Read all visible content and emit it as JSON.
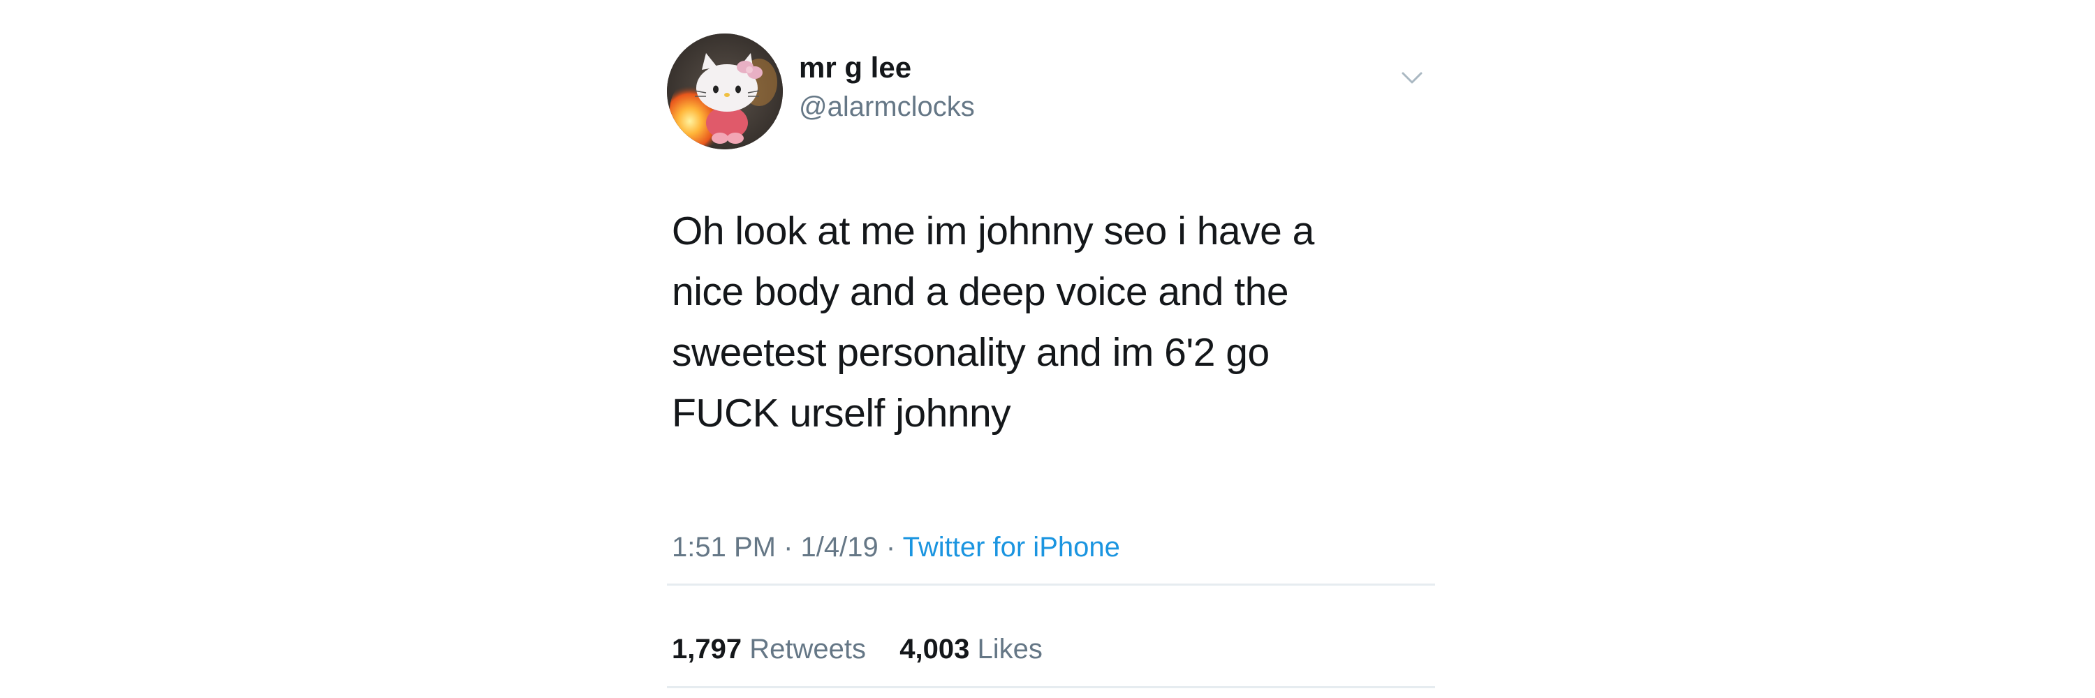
{
  "tweet": {
    "author": {
      "display_name": "mr g lee",
      "handle": "@alarmclocks",
      "avatar_icon": "hello-kitty-on-fire-avatar"
    },
    "menu_icon": "chevron-down-icon",
    "text_lines": [
      "Oh look at me im johnny seo i have a",
      "nice body and a deep voice and the",
      "sweetest personality and im 6'2 go",
      "FUCK urself johnny"
    ],
    "time": "1:51 PM",
    "separator": "·",
    "date": "1/4/19",
    "source": "Twitter for iPhone",
    "stats": {
      "retweets_count": "1,797",
      "retweets_label": "Retweets",
      "likes_count": "4,003",
      "likes_label": "Likes"
    }
  },
  "colors": {
    "text_primary": "#14171a",
    "text_secondary": "#657786",
    "link": "#1b95e0",
    "divider": "#e6ecf0"
  }
}
